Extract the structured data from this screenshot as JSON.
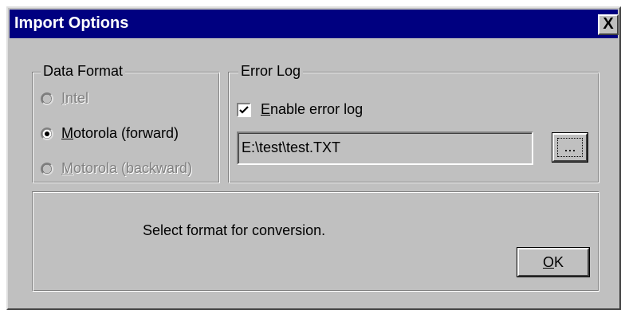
{
  "dialog": {
    "title": "Import Options",
    "close_label": "X"
  },
  "data_format": {
    "label": "Data Format",
    "options": [
      {
        "label_first": "I",
        "label_rest": "ntel",
        "enabled": false,
        "selected": false
      },
      {
        "label_first": "M",
        "label_rest": "otorola (forward)",
        "enabled": true,
        "selected": true
      },
      {
        "label_first": "M",
        "label_rest": "otorola (backward)",
        "enabled": false,
        "selected": false
      }
    ]
  },
  "error_log": {
    "label": "Error Log",
    "enable_label_first": "E",
    "enable_label_rest": "nable error log",
    "enabled": true,
    "path_value": "E:\\test\\test.TXT",
    "browse_label": "..."
  },
  "status": {
    "message": "Select format for conversion."
  },
  "ok_button": {
    "label_first": "O",
    "label_rest": "K"
  }
}
